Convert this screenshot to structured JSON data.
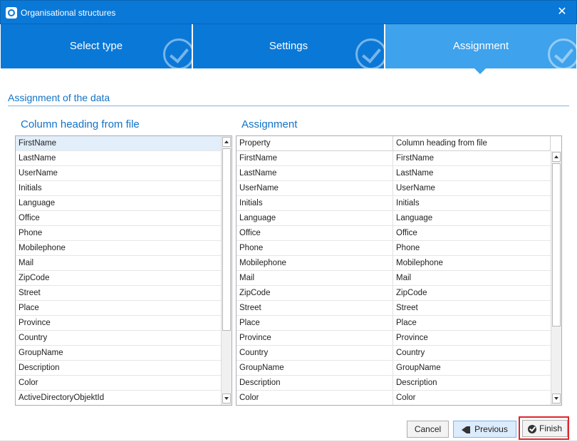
{
  "window": {
    "title": "Organisational structures",
    "close_glyph": "✕",
    "icon": "app-logo-icon"
  },
  "wizard": {
    "steps": [
      {
        "label": "Select type",
        "completed": true,
        "active": false
      },
      {
        "label": "Settings",
        "completed": true,
        "active": false
      },
      {
        "label": "Assignment",
        "completed": true,
        "active": true
      }
    ]
  },
  "section": {
    "title": "Assignment of the data"
  },
  "left_panel": {
    "heading": "Column heading from file",
    "items": [
      "FirstName",
      "LastName",
      "UserName",
      "Initials",
      "Language",
      "Office",
      "Phone",
      "Mobilephone",
      "Mail",
      "ZipCode",
      "Street",
      "Place",
      "Province",
      "Country",
      "GroupName",
      "Description",
      "Color",
      "ActiveDirectoryObjektId"
    ],
    "selected_index": 0
  },
  "right_panel": {
    "heading": "Assignment",
    "columns": [
      "Property",
      "Column heading from file"
    ],
    "rows": [
      [
        "FirstName",
        "FirstName"
      ],
      [
        "LastName",
        "LastName"
      ],
      [
        "UserName",
        "UserName"
      ],
      [
        "Initials",
        "Initials"
      ],
      [
        "Language",
        "Language"
      ],
      [
        "Office",
        "Office"
      ],
      [
        "Phone",
        "Phone"
      ],
      [
        "Mobilephone",
        "Mobilephone"
      ],
      [
        "Mail",
        "Mail"
      ],
      [
        "ZipCode",
        "ZipCode"
      ],
      [
        "Street",
        "Street"
      ],
      [
        "Place",
        "Place"
      ],
      [
        "Province",
        "Province"
      ],
      [
        "Country",
        "Country"
      ],
      [
        "GroupName",
        "GroupName"
      ],
      [
        "Description",
        "Description"
      ],
      [
        "Color",
        "Color"
      ]
    ]
  },
  "buttons": {
    "cancel": "Cancel",
    "previous": "Previous",
    "finish": "Finish"
  },
  "colors": {
    "accent": "#0a78d7",
    "active_step": "#3ea2ec",
    "highlight": "#e0262e"
  }
}
